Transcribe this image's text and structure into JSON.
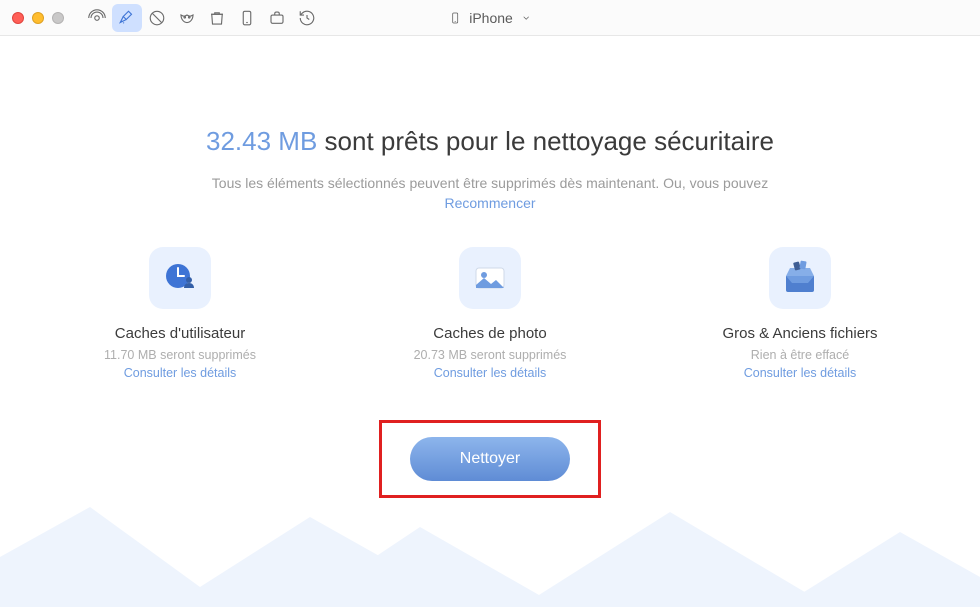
{
  "toolbar": {
    "device_label": "iPhone"
  },
  "headline": {
    "size": "32.43 MB",
    "rest": " sont prêts pour le nettoyage sécuritaire"
  },
  "subline": "Tous les éléments sélectionnés peuvent être supprimés dès maintenant. Ou, vous pouvez",
  "restart_label": "Recommencer",
  "cards": {
    "user_cache": {
      "title": "Caches d'utilisateur",
      "sub": "11.70 MB seront supprimés",
      "link": "Consulter les détails"
    },
    "photo_cache": {
      "title": "Caches de photo",
      "sub": "20.73 MB seront supprimés",
      "link": "Consulter les détails"
    },
    "large_old": {
      "title": "Gros & Anciens fichiers",
      "sub": "Rien à être effacé",
      "link": "Consulter les détails"
    }
  },
  "clean_button": "Nettoyer"
}
